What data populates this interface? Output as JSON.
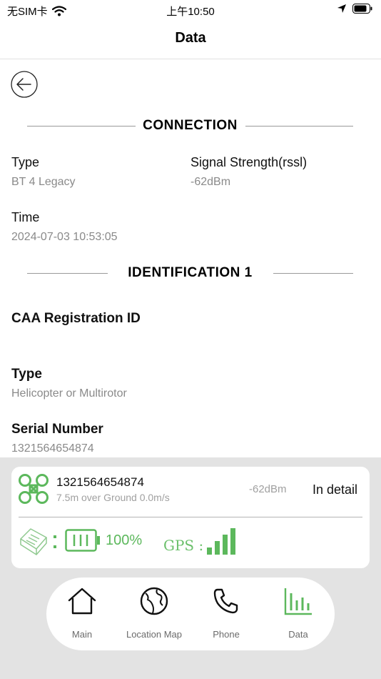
{
  "status_bar": {
    "carrier": "无SIM卡",
    "time": "上午10:50"
  },
  "nav": {
    "title": "Data"
  },
  "connection": {
    "section_title": "CONNECTION",
    "type_label": "Type",
    "type_value": "BT 4 Legacy",
    "signal_label": "Signal Strength(rssl)",
    "signal_value": "-62dBm",
    "time_label": "Time",
    "time_value": "2024-07-03 10:53:05"
  },
  "identification": {
    "section_title": "IDENTIFICATION 1",
    "caa_label": "CAA Registration ID",
    "caa_value": "",
    "type_label": "Type",
    "type_value": "Helicopter or Multirotor",
    "serial_label": "Serial Number",
    "serial_value": "1321564654874"
  },
  "device_card": {
    "serial": "1321564654874",
    "subtitle": "7.5m over Ground 0.0m/s",
    "rssi": "-62dBm",
    "detail_label": "In detail",
    "battery_percent": "100%",
    "gps_label": "GPS :",
    "accent_color": "#5cb85c"
  },
  "tabbar": {
    "items": [
      {
        "label": "Main",
        "icon": "home-icon",
        "active": false
      },
      {
        "label": "Location Map",
        "icon": "globe-icon",
        "active": false
      },
      {
        "label": "Phone",
        "icon": "phone-icon",
        "active": false
      },
      {
        "label": "Data",
        "icon": "bar-chart-icon",
        "active": true
      }
    ]
  }
}
